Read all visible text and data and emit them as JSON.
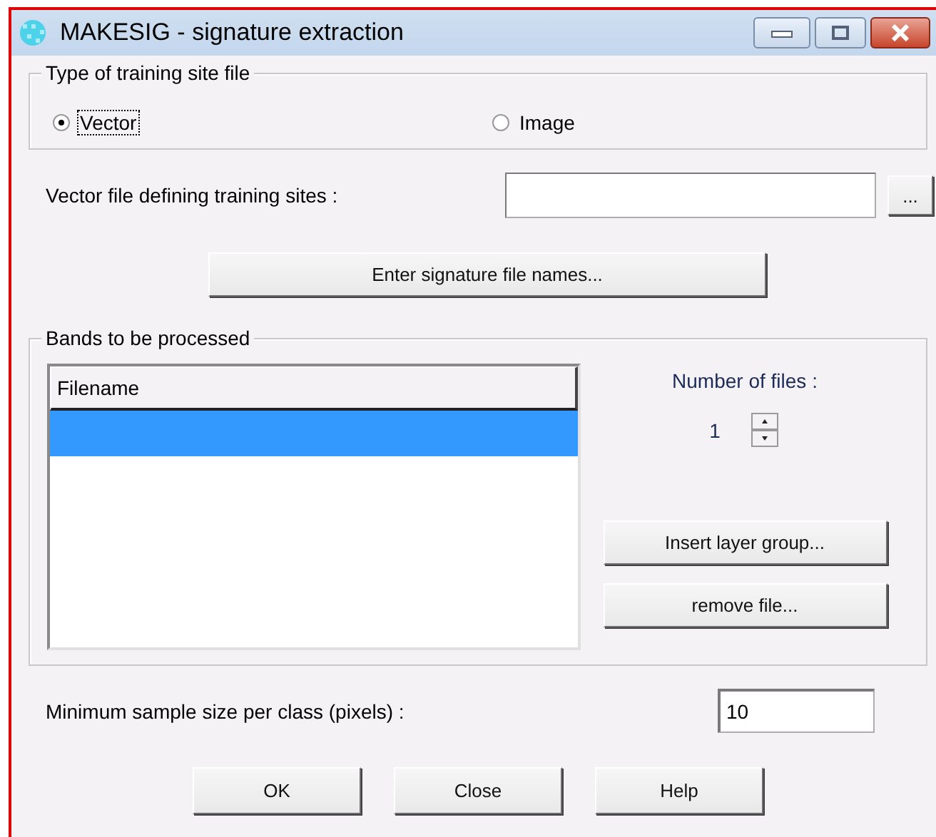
{
  "window": {
    "title": "MAKESIG - signature extraction"
  },
  "training_site_type": {
    "label": "Type of training site file",
    "options": [
      {
        "label": "Vector",
        "selected": true
      },
      {
        "label": "Image",
        "selected": false
      }
    ]
  },
  "vector_file": {
    "label": "Vector file defining training sites :",
    "browse": "..."
  },
  "enter_button": "Enter signature file names...",
  "bands": {
    "label": "Bands to be processed",
    "columns": [
      "Filename"
    ],
    "rows": [
      {
        "selected": true
      }
    ],
    "number_of_files": {
      "label": "Number of files :",
      "value": "1"
    },
    "buttons": [
      "Insert layer group...",
      "remove file..."
    ]
  },
  "min_sample": {
    "label": "Minimum sample size per class (pixels) :",
    "value": "10"
  },
  "buttons": [
    "OK",
    "Close",
    "Help"
  ]
}
